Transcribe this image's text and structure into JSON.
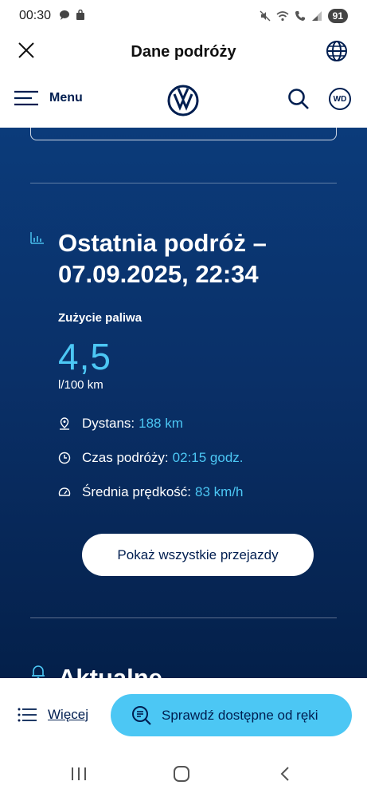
{
  "status_bar": {
    "time": "00:30",
    "battery": "91"
  },
  "title_bar": {
    "title": "Dane podróży"
  },
  "nav": {
    "menu_label": "Menu",
    "account_initials": "WD"
  },
  "trip": {
    "title": "Ostatnia podróż – 07.09.2025, 22:34",
    "fuel_label": "Zużycie paliwa",
    "fuel_value": "4,5",
    "fuel_unit": "l/100 km",
    "stats": [
      {
        "label": "Dystans:",
        "value": "188 km",
        "icon": "location-pin-icon"
      },
      {
        "label": "Czas podróży:",
        "value": "02:15 godz.",
        "icon": "clock-icon"
      },
      {
        "label": "Średnia prędkość:",
        "value": "83 km/h",
        "icon": "speedometer-icon"
      }
    ],
    "all_trips_button": "Pokaż wszystkie przejazdy"
  },
  "next_section": {
    "title": "Aktualne"
  },
  "bottom_bar": {
    "more_label": "Więcej",
    "cta_label": "Sprawdź dostępne od ręki"
  },
  "colors": {
    "brand_dark": "#001e50",
    "accent": "#4cc7f4",
    "panel": "#0a3068"
  }
}
